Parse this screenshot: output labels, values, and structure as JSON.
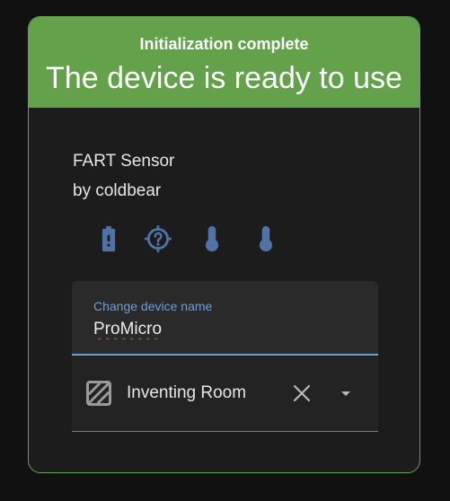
{
  "banner": {
    "subtitle": "Initialization complete",
    "title": "The device is ready to use"
  },
  "device": {
    "name": "FART Sensor",
    "maker": "by coldbear"
  },
  "entity_icons": [
    "battery-alert-icon",
    "crosshairs-question-icon",
    "thermometer-icon",
    "thermometer-icon"
  ],
  "name_field": {
    "label": "Change device name",
    "value": "ProMicro"
  },
  "area_field": {
    "icon": "texture-box-icon",
    "value": "Inventing Room"
  },
  "colors": {
    "banner": "#64a14b",
    "card_border": "#63a24c",
    "icon": "#4f73a7",
    "field_accent": "#6d9fd8"
  }
}
